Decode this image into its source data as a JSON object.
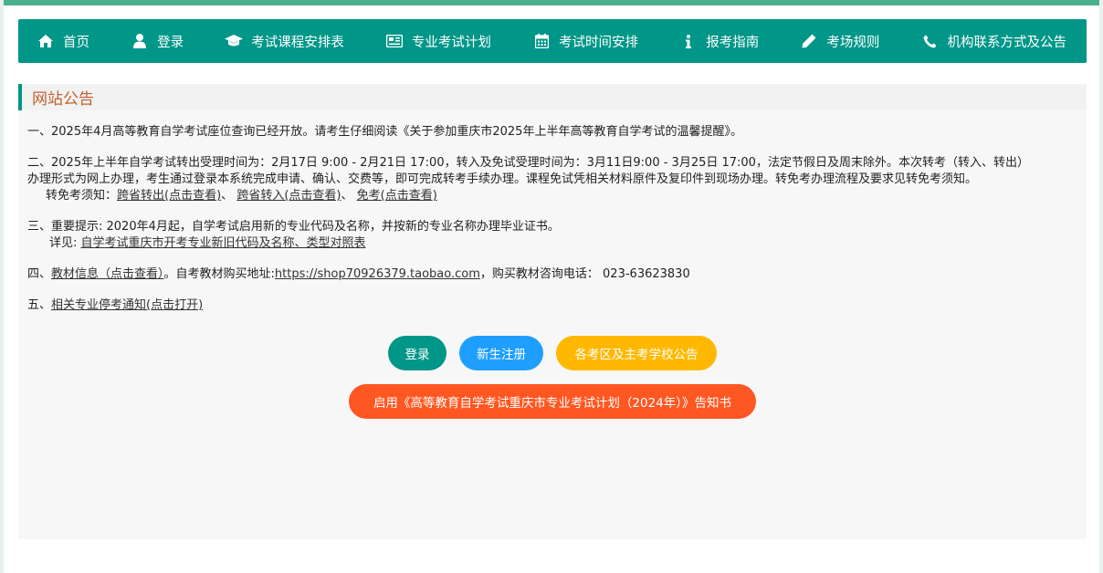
{
  "nav": {
    "items": [
      {
        "label": "首页",
        "icon": "home-icon"
      },
      {
        "label": "登录",
        "icon": "user-icon"
      },
      {
        "label": "考试课程安排表",
        "icon": "graduation-cap-icon"
      },
      {
        "label": "专业考试计划",
        "icon": "newspaper-icon"
      },
      {
        "label": "考试时间安排",
        "icon": "calendar-icon"
      },
      {
        "label": "报考指南",
        "icon": "info-icon"
      },
      {
        "label": "考场规则",
        "icon": "pencil-icon"
      },
      {
        "label": "机构联系方式及公告",
        "icon": "phone-icon"
      }
    ]
  },
  "colors": {
    "brand": "#009688",
    "header_title": "#c0622d",
    "btn_register": "#1e9fff",
    "btn_announce": "#ffb800",
    "btn_notice": "#ff5722"
  },
  "announcement": {
    "title": "网站公告",
    "n1": {
      "text": "一、2025年4月高等教育自学考试座位查询已经开放。请考生仔细阅读《关于参加重庆市2025年上半年高等教育自学考试的温馨提醒》。"
    },
    "n2": {
      "line1": "二、2025年上半年自学考试转出受理时间为：2月17日 9:00 - 2月21日 17:00，转入及免试受理时间为：3月11日9:00 - 3月25日 17:00，法定节假日及周末除外。本次转考（转入、转出）",
      "line2": "办理形式为网上办理，考生通过登录本系统完成申请、确认、交费等，即可完成转考手续办理。课程免试凭相关材料原件及复印件到现场办理。转免考办理流程及要求见转免考须知。",
      "notes_label": "转免考须知：",
      "link1": "跨省转出(点击查看)",
      "sep1": "、",
      "link2": "跨省转入(点击查看)",
      "sep2": "、",
      "link3": "免考(点击查看)"
    },
    "n3": {
      "line1": "三、重要提示: 2020年4月起，自学考试启用新的专业代码及名称，并按新的专业名称办理毕业证书。",
      "detail_label": "详见: ",
      "detail_link": "自学考试重庆市开考专业新旧代码及名称、类型对照表"
    },
    "n4": {
      "prefix": "四、",
      "link": "教材信息（点击查看）",
      "mid": "。自考教材购买地址:",
      "shop_link": "https://shop70926379.taobao.com",
      "suffix": "，购买教材咨询电话： 023-63623830"
    },
    "n5": {
      "prefix": "五、",
      "link": "相关专业停考通知(点击打开)"
    }
  },
  "buttons": {
    "login": "登录",
    "register": "新生注册",
    "announce": "各考区及主考学校公告",
    "notice": "启用《高等教育自学考试重庆市专业考试计划（2024年）》告知书"
  }
}
